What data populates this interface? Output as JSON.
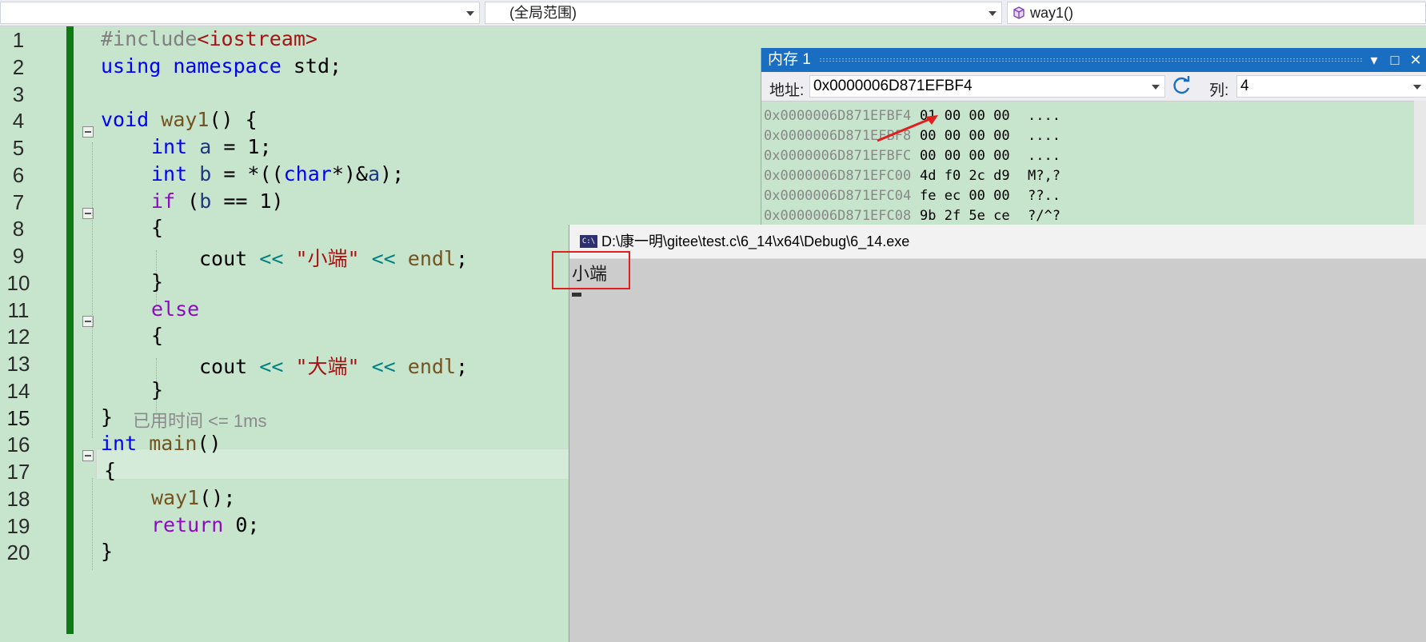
{
  "navbar": {
    "scope_left": "",
    "scope": "(全局范围)",
    "function": "way1()"
  },
  "editor": {
    "line_numbers": [
      "1",
      "2",
      "3",
      "4",
      "5",
      "6",
      "7",
      "8",
      "9",
      "10",
      "11",
      "12",
      "13",
      "14",
      "15",
      "16",
      "17",
      "18",
      "19",
      "20"
    ],
    "current_line": "15",
    "hint": "已用时间 <= 1ms",
    "lines": {
      "l1a": "#include",
      "l1b": "<iostream>",
      "l2a": "using",
      "l2b": "namespace",
      "l2c": "std;",
      "l4a": "void",
      "l4b": "way1",
      "l4c": "() {",
      "l5a": "int",
      "l5b": "a",
      "l5c": " = 1;",
      "l6a": "int",
      "l6b": "b",
      "l6c": " = *((",
      "l6d": "char",
      "l6e": "*)&",
      "l6f": "a",
      "l6g": ");",
      "l7a": "if",
      "l7b": " (",
      "l7c": "b",
      "l7d": " == 1)",
      "l8": "{",
      "l9a": "cout",
      "l9b": "<<",
      "l9c": "\"小端\"",
      "l9d": "<<",
      "l9e": "endl",
      "l9f": ";",
      "l10": "}",
      "l11": "else",
      "l12": "{",
      "l13a": "cout",
      "l13b": "<<",
      "l13c": "\"大端\"",
      "l13d": "<<",
      "l13e": "endl",
      "l13f": ";",
      "l14": "}",
      "l15": "}",
      "l16a": "int",
      "l16b": "main",
      "l16c": "()",
      "l17": "{",
      "l18a": "way1",
      "l18b": "();",
      "l19a": "return",
      "l19b": " 0;",
      "l20": "}"
    }
  },
  "memory": {
    "title": "内存 1",
    "address_label": "地址:",
    "address_value": "0x0000006D871EFBF4",
    "columns_label": "列:",
    "columns_value": "4",
    "rows": [
      {
        "addr": "0x0000006D871EFBF4",
        "bytes": "01 00 00 00",
        "chars": "...."
      },
      {
        "addr": "0x0000006D871EFBF8",
        "bytes": "00 00 00 00",
        "chars": "...."
      },
      {
        "addr": "0x0000006D871EFBFC",
        "bytes": "00 00 00 00",
        "chars": "...."
      },
      {
        "addr": "0x0000006D871EFC00",
        "bytes": "4d f0 2c d9",
        "chars": "M?,?"
      },
      {
        "addr": "0x0000006D871EFC04",
        "bytes": "fe ec 00 00",
        "chars": "??.."
      },
      {
        "addr": "0x0000006D871EFC08",
        "bytes": "9b 2f 5e ce",
        "chars": "?/^?"
      }
    ]
  },
  "console": {
    "icon_text": "C:\\",
    "title": "D:\\康一明\\gitee\\test.c\\6_14\\x64\\Debug\\6_14.exe",
    "output": "小端"
  },
  "colors": {
    "editor_bg": "#c7e4cc",
    "keyword": "#0000ff",
    "control_keyword": "#8f08c4",
    "function": "#74531f",
    "string": "#a31515",
    "operator": "#008080",
    "title_bar": "#1a6ec2",
    "change_bar": "#0f7a14",
    "annotation": "#e02020"
  }
}
